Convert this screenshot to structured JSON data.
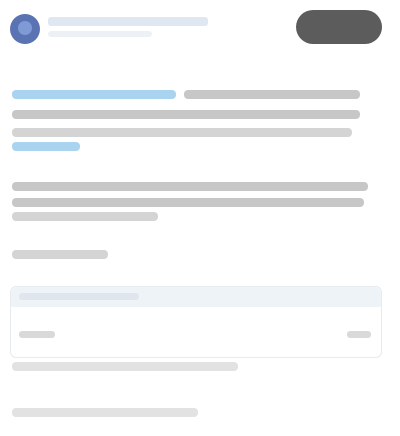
{
  "header": {
    "account_name": "",
    "action_button_label": ""
  },
  "post": {
    "paragraph_1": "",
    "paragraph_2": "",
    "show_more": ""
  },
  "card": {
    "title": "",
    "left_meta": "",
    "right_meta": ""
  },
  "footer": {
    "line_1": "",
    "line_2": ""
  },
  "colors": {
    "accent": "#5a73b3",
    "link": "#a9d3ef",
    "button": "#5c5c5c",
    "card_header": "#eef3f8"
  },
  "icons": {
    "avatar": "avatar-icon"
  }
}
